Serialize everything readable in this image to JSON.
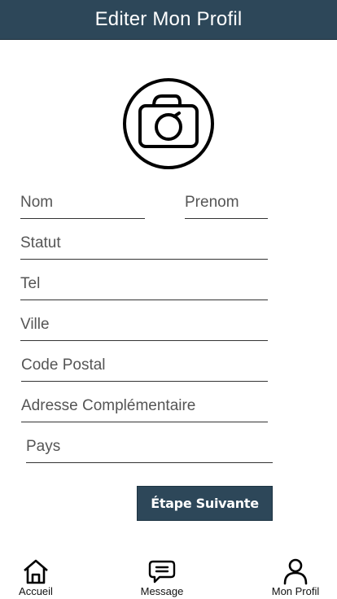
{
  "header": {
    "title": "Editer Mon Profil"
  },
  "form": {
    "nom_placeholder": "Nom",
    "prenom_placeholder": "Prenom",
    "statut_placeholder": "Statut",
    "tel_placeholder": "Tel",
    "ville_placeholder": "Ville",
    "code_postal_placeholder": "Code Postal",
    "adresse_placeholder": "Adresse Complémentaire",
    "pays_placeholder": "Pays"
  },
  "next_button": {
    "label": "Étape Suivante"
  },
  "tabbar": {
    "items": [
      {
        "label": "Accueil",
        "icon": "home-icon"
      },
      {
        "label": "Message",
        "icon": "message-icon"
      },
      {
        "label": "Mon Profil",
        "icon": "user-icon"
      }
    ]
  },
  "colors": {
    "primary": "#2d4759",
    "text": "#111111",
    "placeholder": "#555555"
  }
}
